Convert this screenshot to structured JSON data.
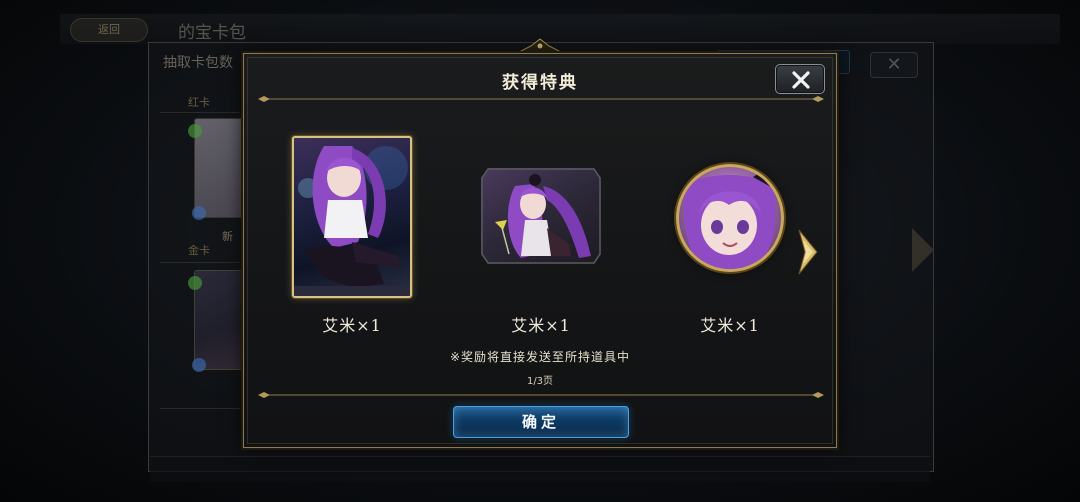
{
  "background": {
    "back_label": "返回",
    "page_title": "的宝卡包",
    "panel_title": "抽取卡包数",
    "row_red": "红卡",
    "row_gold": "金卡",
    "new_badge": "新"
  },
  "modal": {
    "title": "获得特典",
    "items": [
      {
        "type": "card",
        "label": "艾米×1"
      },
      {
        "type": "stamp",
        "label": "艾米×1"
      },
      {
        "type": "avatar",
        "label": "艾米×1"
      }
    ],
    "note": "※奖励将直接发送至所持道具中",
    "page_indicator": "1/3页",
    "confirm_label": "确定"
  },
  "colors": {
    "gold_border": "#8d7a4e",
    "confirm_blue": "#1d5a8e",
    "hair_purple": "#8e4bc4"
  }
}
